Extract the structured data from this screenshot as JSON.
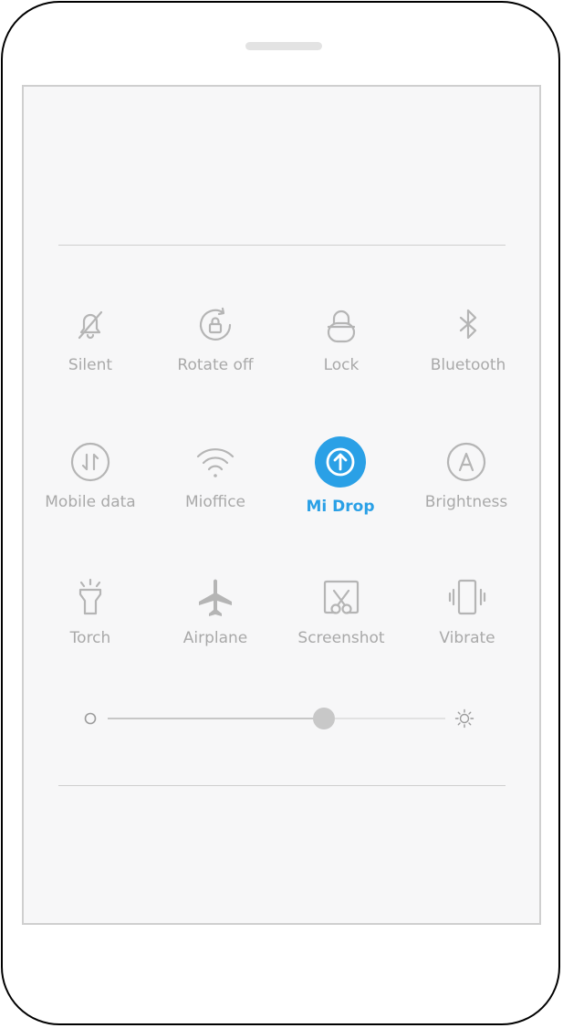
{
  "tiles": [
    {
      "label": "Silent",
      "icon": "bell-off-icon"
    },
    {
      "label": "Rotate off",
      "icon": "rotate-lock-icon"
    },
    {
      "label": "Lock",
      "icon": "lock-icon"
    },
    {
      "label": "Bluetooth",
      "icon": "bluetooth-icon"
    },
    {
      "label": "Mobile data",
      "icon": "mobile-data-icon"
    },
    {
      "label": "Mioffice",
      "icon": "wifi-icon"
    },
    {
      "label": "Mi Drop",
      "icon": "mi-drop-icon"
    },
    {
      "label": "Brightness",
      "icon": "auto-brightness-icon"
    },
    {
      "label": "Torch",
      "icon": "torch-icon"
    },
    {
      "label": "Airplane",
      "icon": "airplane-icon"
    },
    {
      "label": "Screenshot",
      "icon": "screenshot-icon"
    },
    {
      "label": "Vibrate",
      "icon": "vibrate-icon"
    }
  ],
  "brightness": {
    "level": 0.64
  },
  "colors": {
    "accent": "#2aa0e6",
    "inactive": "#a9a9a9",
    "panel": "#f7f7f8"
  }
}
